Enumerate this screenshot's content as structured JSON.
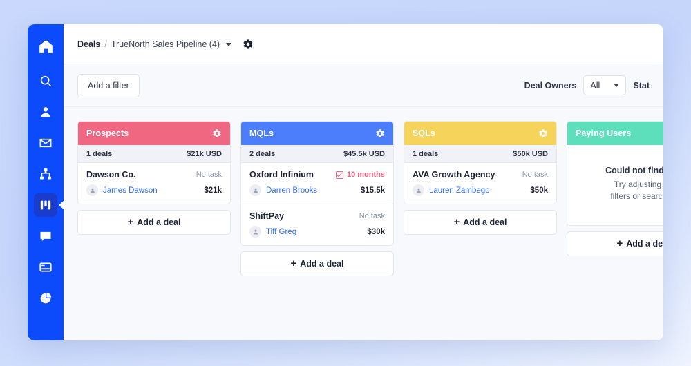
{
  "sidebar": {
    "items": [
      {
        "name": "home-icon",
        "label": "Home",
        "active": false
      },
      {
        "name": "search-icon",
        "label": "Search",
        "active": false
      },
      {
        "name": "contacts-icon",
        "label": "Contacts",
        "active": false
      },
      {
        "name": "mail-icon",
        "label": "Mail",
        "active": false
      },
      {
        "name": "org-chart-icon",
        "label": "Organization",
        "active": false
      },
      {
        "name": "kanban-icon",
        "label": "Deals",
        "active": true
      },
      {
        "name": "chat-icon",
        "label": "Chat",
        "active": false
      },
      {
        "name": "billing-icon",
        "label": "Billing",
        "active": false
      },
      {
        "name": "reports-icon",
        "label": "Reports",
        "active": false
      }
    ]
  },
  "topbar": {
    "breadcrumb_root": "Deals",
    "breadcrumb_separator": "/",
    "breadcrumb_current": "TrueNorth Sales Pipeline (4)",
    "settings_icon": "gear-icon"
  },
  "filterbar": {
    "add_filter_label": "Add a filter",
    "deal_owners_label": "Deal Owners",
    "deal_owners_value": "All",
    "status_label": "Stat"
  },
  "board": {
    "add_deal_label": "Add a deal",
    "empty": {
      "title": "Could not find any",
      "line1": "Try adjusting yo",
      "line2": "filters or search te"
    },
    "columns": [
      {
        "title": "Prospects",
        "color": "#f06782",
        "count": "1 deals",
        "total": "$21k USD",
        "deals": [
          {
            "name": "Dawson Co.",
            "task": "No task",
            "has_task": false,
            "owner": "James Dawson",
            "amount": "$21k"
          }
        ]
      },
      {
        "title": "MQLs",
        "color": "#4c7dfa",
        "count": "2 deals",
        "total": "$45.5k USD",
        "deals": [
          {
            "name": "Oxford Infinium",
            "task": "10 months",
            "has_task": true,
            "owner": "Darren Brooks",
            "amount": "$15.5k"
          },
          {
            "name": "ShiftPay",
            "task": "No task",
            "has_task": false,
            "owner": "Tiff Greg",
            "amount": "$30k"
          }
        ]
      },
      {
        "title": "SQLs",
        "color": "#f6d35b",
        "count": "1 deals",
        "total": "$50k USD",
        "deals": [
          {
            "name": "AVA Growth Agency",
            "task": "No task",
            "has_task": false,
            "owner": "Lauren Zambego",
            "amount": "$50k"
          }
        ]
      },
      {
        "title": "Paying Users",
        "color": "#5edfbc",
        "count": "",
        "total": "",
        "deals": [],
        "is_empty": true
      }
    ]
  }
}
